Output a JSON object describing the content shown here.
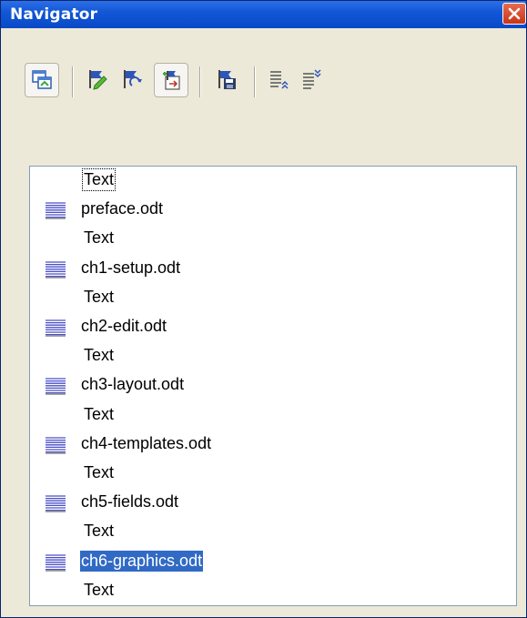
{
  "window": {
    "title": "Navigator"
  },
  "toolbar": {
    "buttons": [
      {
        "name": "toggle-icon"
      },
      {
        "name": "edit-flag-icon"
      },
      {
        "name": "update-flag-icon"
      },
      {
        "name": "insert-icon"
      },
      {
        "name": "save-as-icon"
      },
      {
        "name": "move-up-icon"
      },
      {
        "name": "move-down-icon"
      }
    ]
  },
  "list": {
    "items": [
      {
        "label": "Text",
        "type": "text"
      },
      {
        "label": "preface.odt",
        "type": "document"
      },
      {
        "label": "Text",
        "type": "text"
      },
      {
        "label": "ch1-setup.odt",
        "type": "document"
      },
      {
        "label": "Text",
        "type": "text"
      },
      {
        "label": "ch2-edit.odt",
        "type": "document"
      },
      {
        "label": "Text",
        "type": "text"
      },
      {
        "label": "ch3-layout.odt",
        "type": "document"
      },
      {
        "label": "Text",
        "type": "text"
      },
      {
        "label": "ch4-templates.odt",
        "type": "document"
      },
      {
        "label": "Text",
        "type": "text"
      },
      {
        "label": "ch5-fields.odt",
        "type": "document"
      },
      {
        "label": "Text",
        "type": "text"
      },
      {
        "label": "ch6-graphics.odt",
        "type": "document",
        "selected": true
      },
      {
        "label": "Text",
        "type": "text"
      }
    ]
  },
  "colors": {
    "titlebar": "#0A49C8",
    "selection": "#316AC5",
    "panel": "#ECE9D8"
  }
}
